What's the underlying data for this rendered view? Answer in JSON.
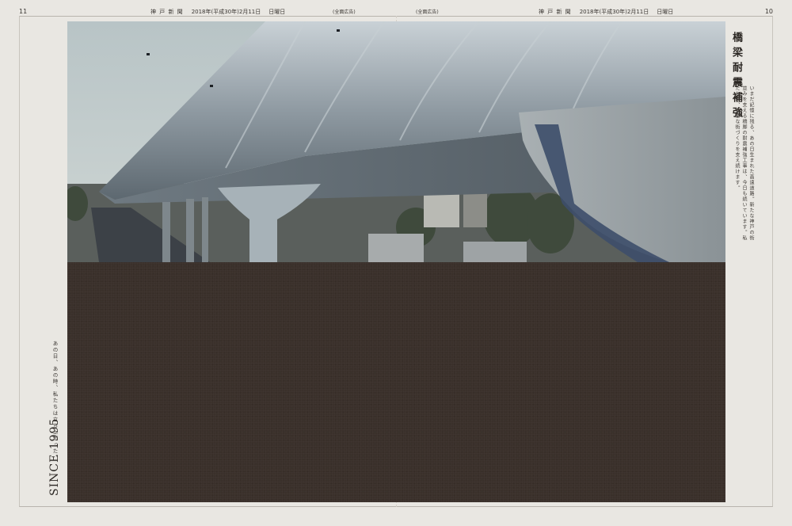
{
  "header": {
    "page_left": "11",
    "page_right": "10",
    "left": {
      "masthead": "神 戸 新 聞",
      "date": "2018年(平成30年)2月11日",
      "weekday": "日曜日"
    },
    "right": {
      "masthead": "神 戸 新 聞",
      "date": "2018年(平成30年)2月11日",
      "weekday": "日曜日"
    },
    "center_tag_1": "(全面広告)",
    "center_tag_2": "(全面広告)"
  },
  "headline": "橋梁耐震補強",
  "body_text": "いまだ記憶に残る、あの日生まれた高速道路。新たな神戸の街並みを支える橋脚の耐震補強工事は、今日も続いています。私たちは、安全な街づくりを支え続けます。",
  "catch_copy": "あの日、あの時、私たちは立ち上がった。",
  "since": "SINCE 1995"
}
